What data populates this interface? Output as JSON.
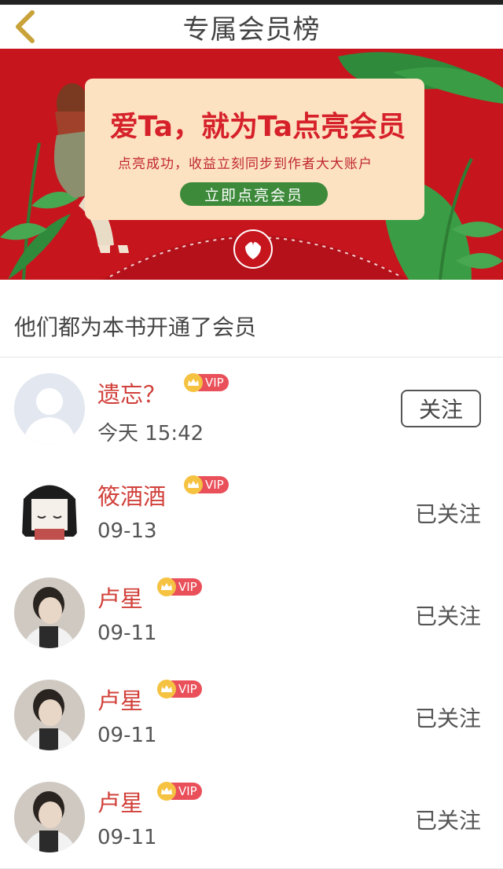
{
  "header": {
    "title": "专属会员榜"
  },
  "banner": {
    "headline": "爱Ta，就为Ta点亮会员",
    "subtitle": "点亮成功，收益立刻同步到作者大大账户",
    "button": "立即点亮会员"
  },
  "section_title": "他们都为本书开通了会员",
  "vip_label": "VIP",
  "members": [
    {
      "name": "遗忘？",
      "date": "今天 15:42",
      "action": "关注",
      "followed": false,
      "avatar": "default-avatar"
    },
    {
      "name": "筱酒酒",
      "date": "09-13",
      "action": "已关注",
      "followed": true,
      "avatar": "cartoon-girl-avatar"
    },
    {
      "name": "卢星",
      "date": "09-11",
      "action": "已关注",
      "followed": true,
      "avatar": "photo-avatar"
    },
    {
      "name": "卢星",
      "date": "09-11",
      "action": "已关注",
      "followed": true,
      "avatar": "photo-avatar"
    },
    {
      "name": "卢星",
      "date": "09-11",
      "action": "已关注",
      "followed": true,
      "avatar": "photo-avatar"
    }
  ],
  "colors": {
    "accent": "#d1403a",
    "banner_red": "#c7151d",
    "back_icon": "#c9a23a"
  }
}
